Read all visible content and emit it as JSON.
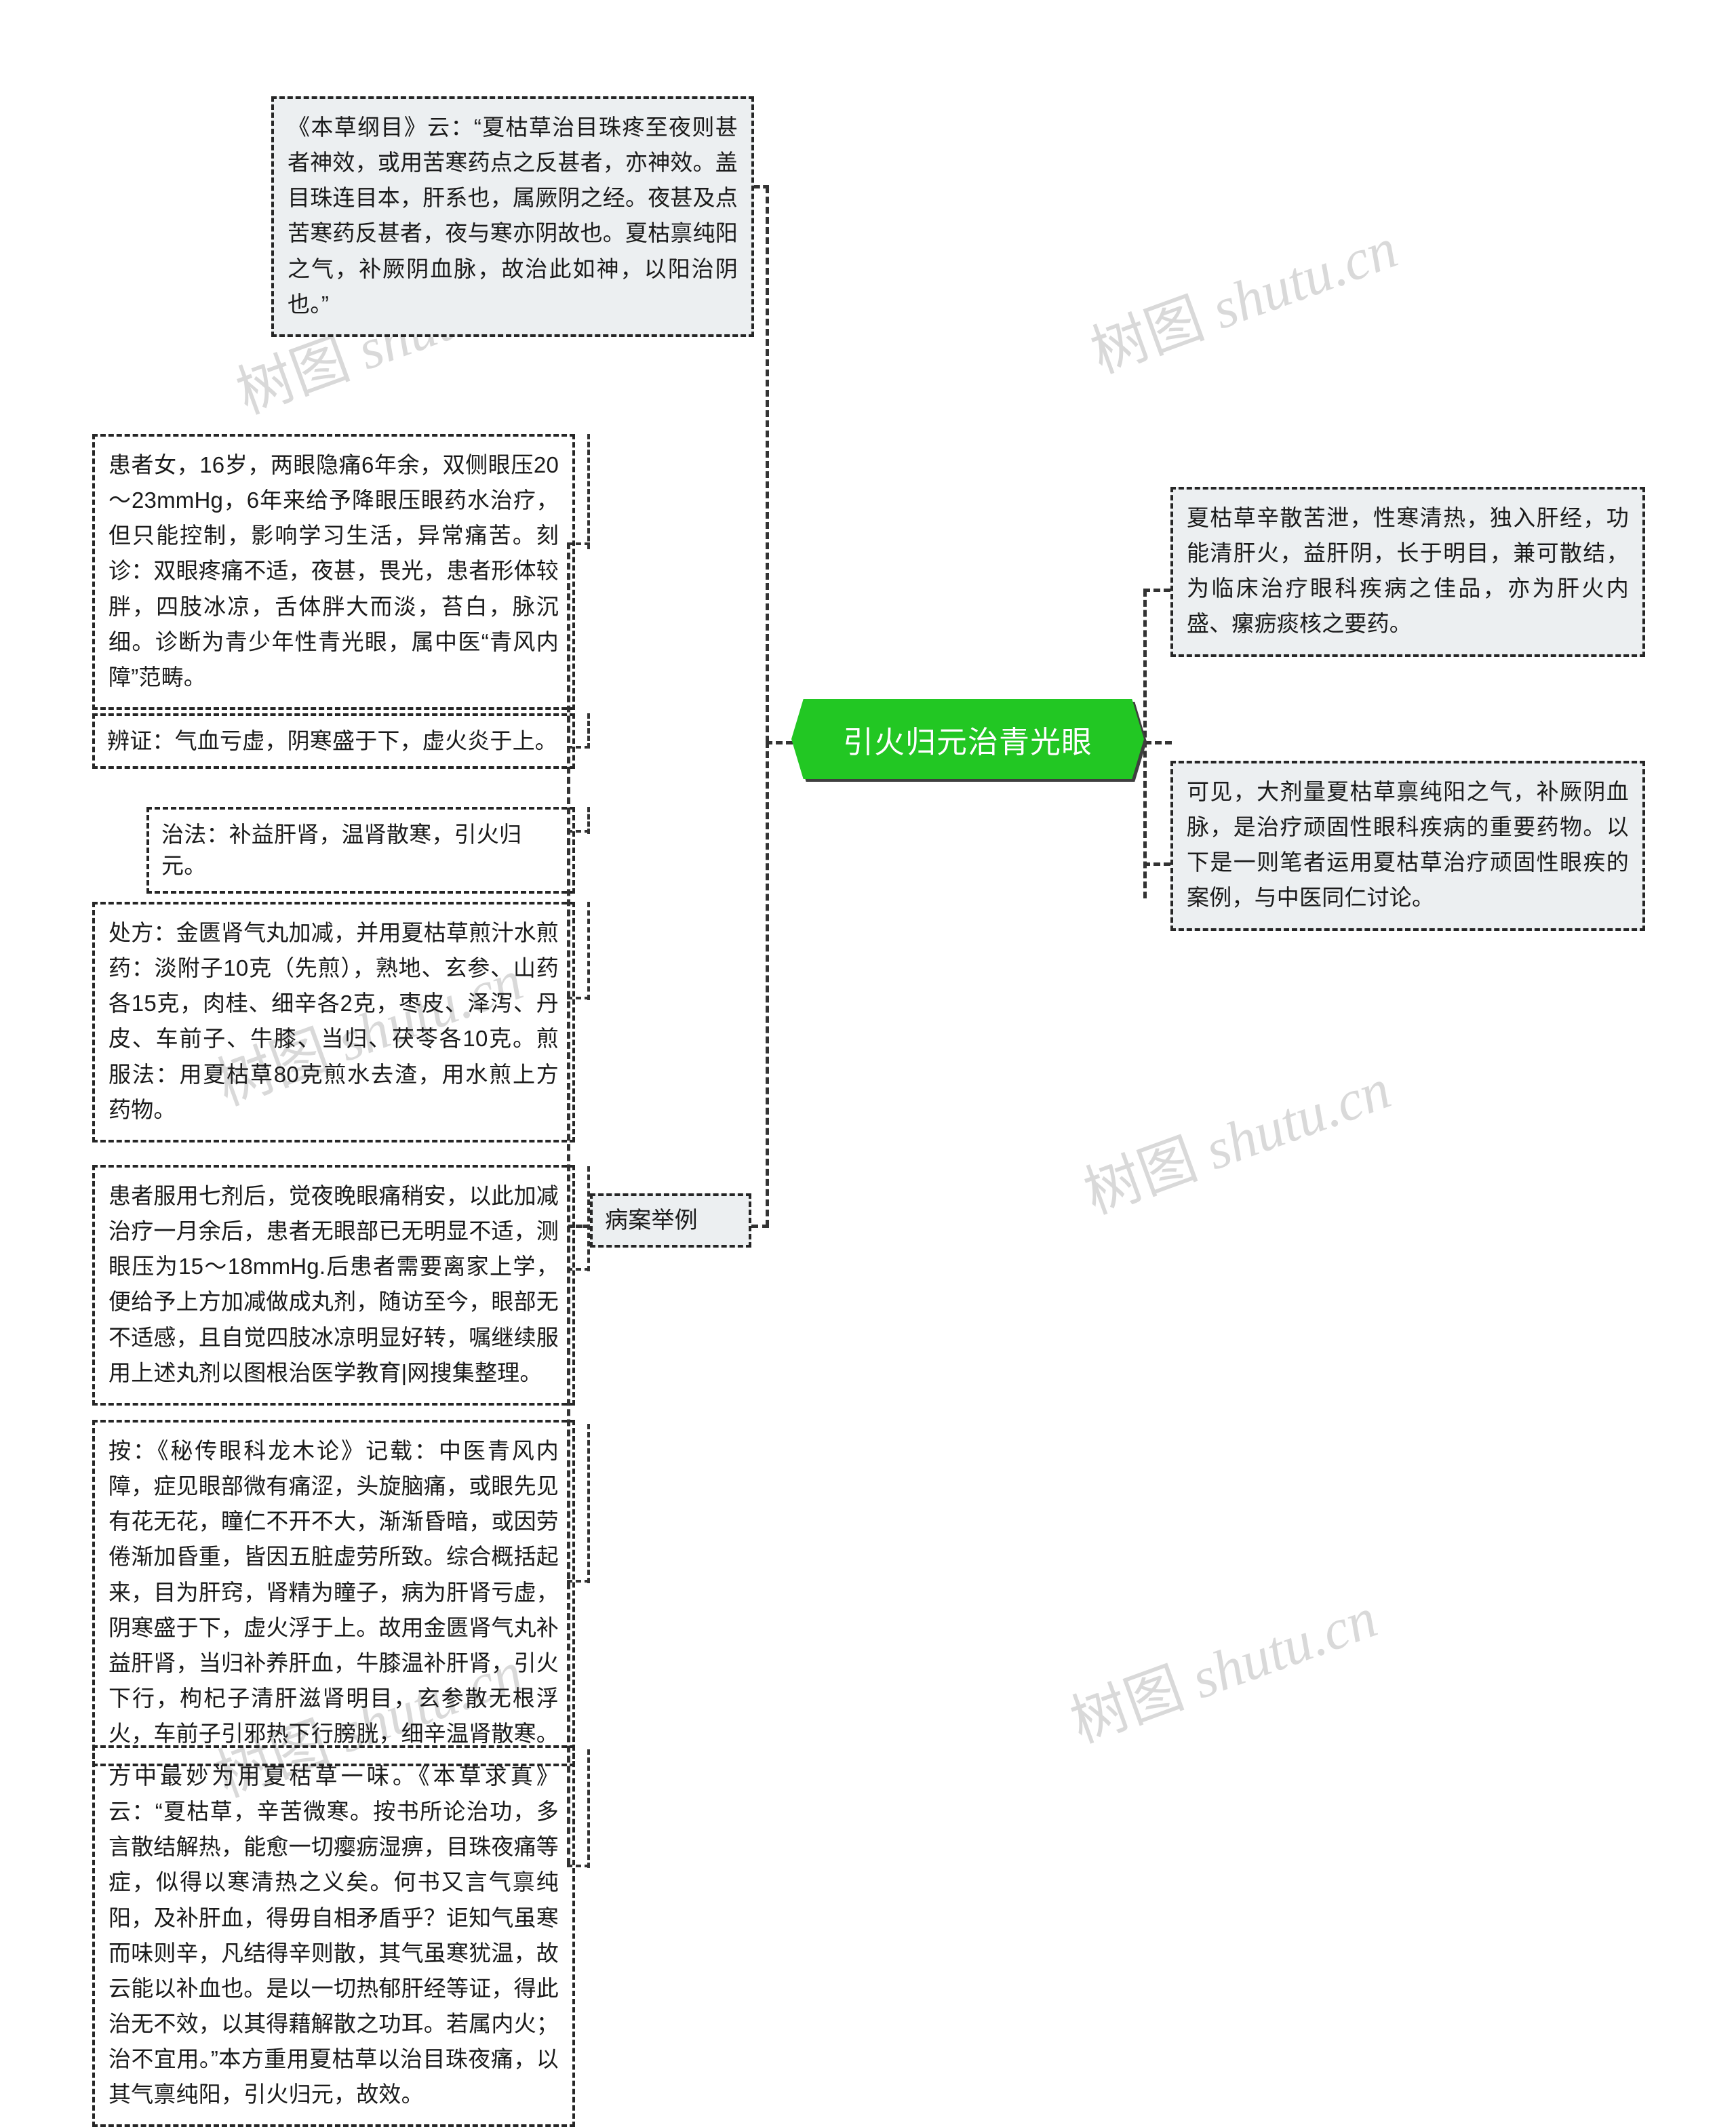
{
  "map": {
    "center": {
      "label": "引火归元治青光眼",
      "fill": "#22c723",
      "text_color": "#ffffff"
    },
    "node_fill": "#eceff1",
    "border_color": "#262626",
    "watermark_text": "树图 shutu.cn",
    "top_branch": {
      "text": "《本草纲目》云：“夏枯草治目珠疼至夜则甚者神效，或用苦寒药点之反甚者，亦神效。盖目珠连目本，肝系也，属厥阴之经。夜甚及点苦寒药反甚者，夜与寒亦阴故也。夏枯禀纯阳之气，补厥阴血脉，故治此如神，以阳治阴也。”"
    },
    "right_branches": [
      {
        "text": "夏枯草辛散苦泄，性寒清热，独入肝经，功能清肝火，益肝阴，长于明目，兼可散结，为临床治疗眼科疾病之佳品，亦为肝火内盛、瘰疬痰核之要药。"
      },
      {
        "text": "可见，大剂量夏枯草禀纯阳之气，补厥阴血脉，是治疗顽固性眼科疾病的重要药物。以下是一则笔者运用夏枯草治疗顽固性眼疾的案例，与中医同仁讨论。"
      }
    ],
    "case_branch": {
      "label": "病案举例",
      "children": [
        {
          "id": "patient-history",
          "text": "患者女，16岁，两眼隐痛6年余，双侧眼压20～23mmHg，6年来给予降眼压眼药水治疗，但只能控制，影响学习生活，异常痛苦。刻诊：双眼疼痛不适，夜甚，畏光，患者形体较胖，四肢冰凉，舌体胖大而淡，苔白，脉沉细。诊断为青少年性青光眼，属中医“青风内障”范畴。"
        },
        {
          "id": "syndrome-differentiation",
          "text": "辨证：气血亏虚，阴寒盛于下，虚火炎于上。"
        },
        {
          "id": "treatment-method",
          "text": "治法：补益肝肾，温肾散寒，引火归元。"
        },
        {
          "id": "prescription",
          "text": "处方：金匮肾气丸加减，并用夏枯草煎汁水煎药：淡附子10克（先煎），熟地、玄参、山药各15克，肉桂、细辛各2克，枣皮、泽泻、丹皮、车前子、牛膝、当归、茯苓各10克。煎服法：用夏枯草80克煎水去渣，用水煎上方药物。"
        },
        {
          "id": "follow-up",
          "text": "患者服用七剂后，觉夜晚眼痛稍安，以此加减治疗一月余后，患者无眼部已无明显不适，测眼压为15～18mmHg.后患者需要离家上学，便给予上方加减做成丸剂，随访至今，眼部无不适感，且自觉四肢冰凉明显好转，嘱继续服用上述丸剂以图根治医学教育|网搜集整理。"
        },
        {
          "id": "commentary-an",
          "text": "按：《秘传眼科龙木论》记载：中医青风内障，症见眼部微有痛涩，头旋脑痛，或眼先见有花无花，瞳仁不开不大，渐渐昏暗，或因劳倦渐加昏重，皆因五脏虚劳所致。综合概括起来，目为肝窍，肾精为瞳子，病为肝肾亏虚，阴寒盛于下，虚火浮于上。故用金匮肾气丸补益肝肾，当归补养肝血，牛膝温补肝肾，引火下行，枸杞子清肝滋肾明目，玄参散无根浮火，车前子引邪热下行膀胱，细辛温肾散寒。"
        },
        {
          "id": "commentary-xiakucao",
          "text": "方中最妙为用夏枯草一味。《本草求真》云：“夏枯草，辛苦微寒。按书所论治功，多言散结解热，能愈一切瘿疬湿痹，目珠夜痛等症，似得以寒清热之义矣。何书又言气禀纯阳，及补肝血，得毋自相矛盾乎？讵知气虽寒而味则辛，凡结得辛则散，其气虽寒犹温，故云能以补血也。是以一切热郁肝经等证，得此治无不效，以其得藉解散之功耳。若属内火；治不宜用。”本方重用夏枯草以治目珠夜痛，以其气禀纯阳，引火归元，故效。"
        }
      ]
    }
  }
}
